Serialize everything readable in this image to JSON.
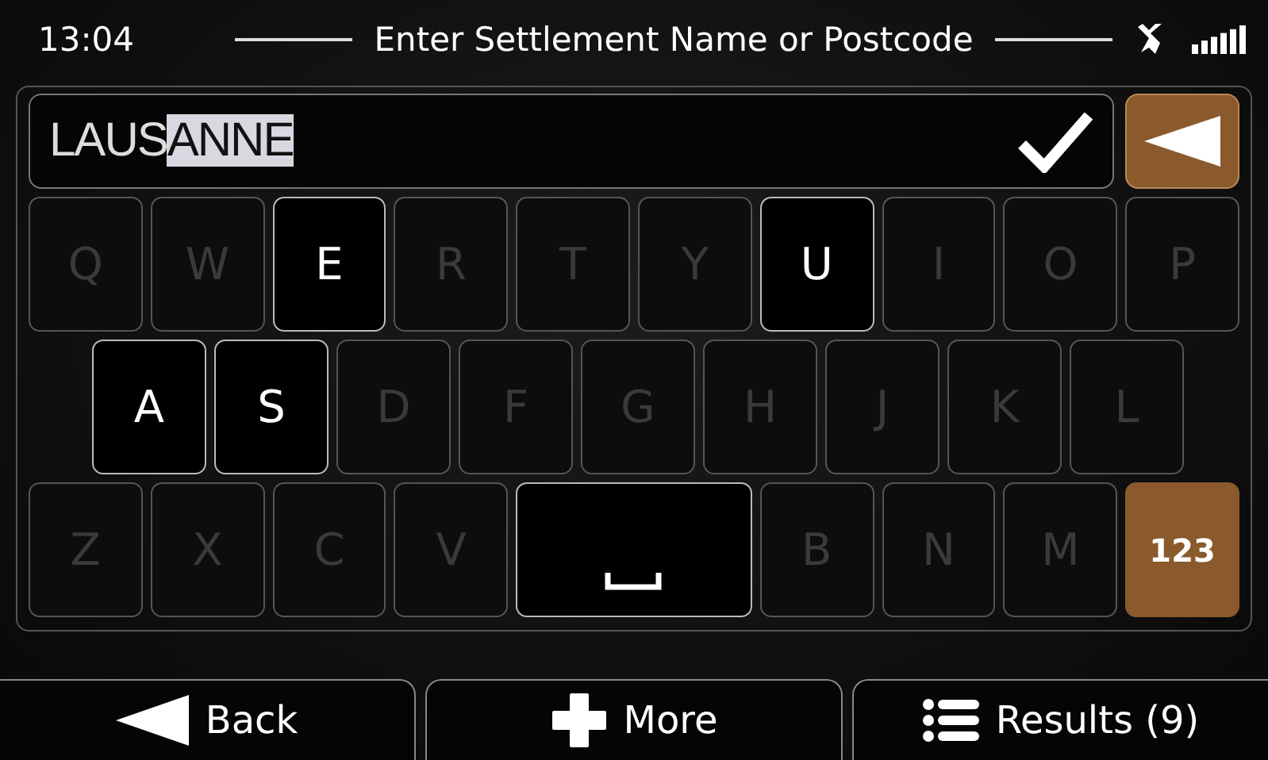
{
  "status_bar": {
    "time": "13:04",
    "title": "Enter Settlement Name or Postcode"
  },
  "input": {
    "typed": "LAUS",
    "completion": "ANNE"
  },
  "keyboard": {
    "keys": [
      {
        "kind": "letter",
        "label": "Q",
        "disabled": true
      },
      {
        "kind": "letter",
        "label": "W",
        "disabled": true
      },
      {
        "kind": "letter",
        "label": "E",
        "disabled": false
      },
      {
        "kind": "letter",
        "label": "R",
        "disabled": true
      },
      {
        "kind": "letter",
        "label": "T",
        "disabled": true
      },
      {
        "kind": "letter",
        "label": "Y",
        "disabled": true
      },
      {
        "kind": "letter",
        "label": "U",
        "disabled": false
      },
      {
        "kind": "letter",
        "label": "I",
        "disabled": true
      },
      {
        "kind": "letter",
        "label": "O",
        "disabled": true
      },
      {
        "kind": "letter",
        "label": "P",
        "disabled": true
      },
      {
        "kind": "letter",
        "label": "A",
        "disabled": false
      },
      {
        "kind": "letter",
        "label": "S",
        "disabled": false
      },
      {
        "kind": "letter",
        "label": "D",
        "disabled": true
      },
      {
        "kind": "letter",
        "label": "F",
        "disabled": true
      },
      {
        "kind": "letter",
        "label": "G",
        "disabled": true
      },
      {
        "kind": "letter",
        "label": "H",
        "disabled": true
      },
      {
        "kind": "letter",
        "label": "J",
        "disabled": true
      },
      {
        "kind": "letter",
        "label": "K",
        "disabled": true
      },
      {
        "kind": "letter",
        "label": "L",
        "disabled": true
      },
      {
        "kind": "letter",
        "label": "Z",
        "disabled": true
      },
      {
        "kind": "letter",
        "label": "X",
        "disabled": true
      },
      {
        "kind": "letter",
        "label": "C",
        "disabled": true
      },
      {
        "kind": "letter",
        "label": "V",
        "disabled": true
      },
      {
        "kind": "space",
        "disabled": false
      },
      {
        "kind": "letter",
        "label": "B",
        "disabled": true
      },
      {
        "kind": "letter",
        "label": "N",
        "disabled": true
      },
      {
        "kind": "letter",
        "label": "M",
        "disabled": true
      },
      {
        "kind": "mode",
        "label": "123",
        "disabled": false
      }
    ]
  },
  "bottom_buttons": [
    {
      "kind": "back",
      "label": "Back"
    },
    {
      "kind": "more",
      "label": "More"
    },
    {
      "kind": "results",
      "label": "Results (9)"
    }
  ]
}
